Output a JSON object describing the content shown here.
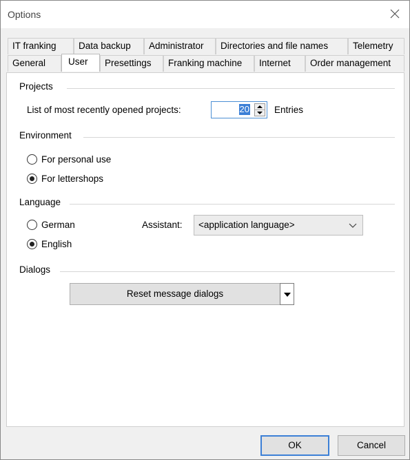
{
  "window": {
    "title": "Options",
    "close_icon": "close-x-icon"
  },
  "tabs": {
    "row1": [
      "IT franking",
      "Data backup",
      "Administrator",
      "Directories and file names",
      "Telemetry"
    ],
    "row2": [
      "General",
      "User",
      "Presettings",
      "Franking machine",
      "Internet",
      "Order management"
    ],
    "active": "User"
  },
  "projects": {
    "heading": "Projects",
    "label": "List of most recently opened projects:",
    "value": "20",
    "unit": "Entries"
  },
  "environment": {
    "heading": "Environment",
    "options": [
      {
        "label": "For personal use",
        "checked": false
      },
      {
        "label": "For lettershops",
        "checked": true
      }
    ]
  },
  "language": {
    "heading": "Language",
    "options": [
      {
        "label": "German",
        "checked": false
      },
      {
        "label": "English",
        "checked": true
      }
    ],
    "assistant_label": "Assistant:",
    "assistant_value": "<application language>"
  },
  "dialogs": {
    "heading": "Dialogs",
    "reset_button": "Reset message dialogs"
  },
  "footer": {
    "ok": "OK",
    "cancel": "Cancel"
  },
  "colors": {
    "accent": "#3b7fd6",
    "panel": "#ffffff",
    "chrome": "#f0f0f0"
  }
}
